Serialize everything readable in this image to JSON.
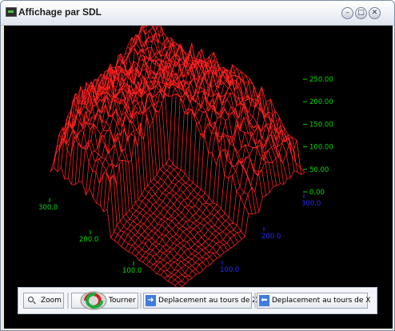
{
  "window": {
    "title": "Affichage par SDL"
  },
  "title_buttons": {
    "minimize": "–",
    "maximize": "□",
    "close": "✕"
  },
  "icons": [
    "app-icon",
    "minimize-icon",
    "maximize-icon",
    "close-icon",
    "zoom-icon",
    "rotate-icon",
    "arrow-right-icon",
    "arrow-left-icon"
  ],
  "plot": {
    "z_axis": {
      "labels": [
        "250.00",
        "200.00",
        "150.00",
        "100.00",
        "50.00",
        "0.00"
      ],
      "color": "#00dd00"
    },
    "left_axis": {
      "labels": [
        "300.0",
        "200.0",
        "100.0"
      ],
      "color": "#00dd00"
    },
    "right_axis": {
      "labels": [
        "300.0",
        "200.0",
        "100.0"
      ],
      "color": "#2a2aff"
    },
    "mesh_color": "#ff2020",
    "background": "#000000"
  },
  "toolbar": {
    "zoom_label": "Zoom",
    "tourner_label": "Tourner",
    "rotate_z_label": "Deplacement au tours de Z",
    "rotate_x_label": "Deplacement au tours de X"
  }
}
